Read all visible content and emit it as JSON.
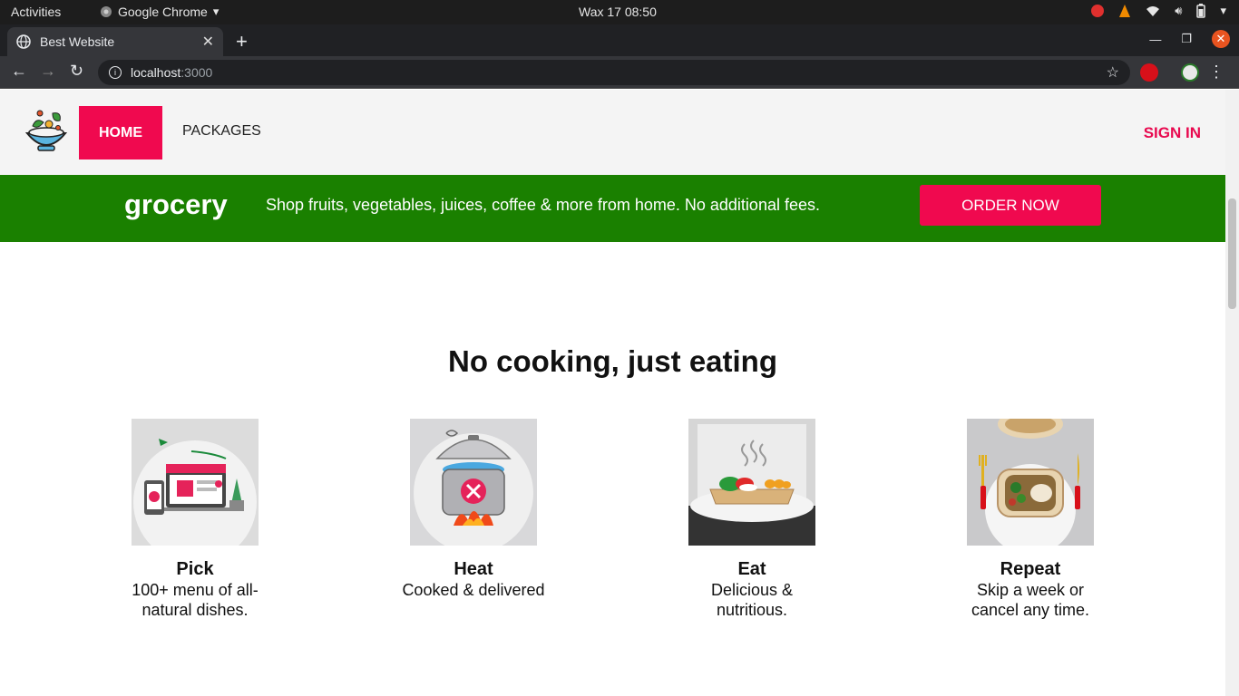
{
  "os_bar": {
    "activities": "Activities",
    "app_name": "Google Chrome",
    "clock": "Wax 17  08:50"
  },
  "browser": {
    "tab_title": "Best Website",
    "url_host": "localhost",
    "url_port": ":3000"
  },
  "site": {
    "nav": {
      "home": "HOME",
      "packages": "PACKAGES",
      "sign_in": "SIGN IN"
    },
    "promo": {
      "brand": "grocery",
      "text": "Shop fruits, vegetables, juices, coffee & more from home. No additional fees.",
      "button": "ORDER NOW"
    },
    "heading": "No cooking, just eating",
    "steps": [
      {
        "name": "Pick",
        "desc": "100+ menu of all-natural dishes."
      },
      {
        "name": "Heat",
        "desc": "Cooked & delivered"
      },
      {
        "name": "Eat",
        "desc": "Delicious & nutritious."
      },
      {
        "name": "Repeat",
        "desc": "Skip a week or cancel any time."
      }
    ]
  },
  "colors": {
    "accent": "#f0094f",
    "promo_bg": "#1a8000",
    "header_bg": "#f4f4f4"
  }
}
